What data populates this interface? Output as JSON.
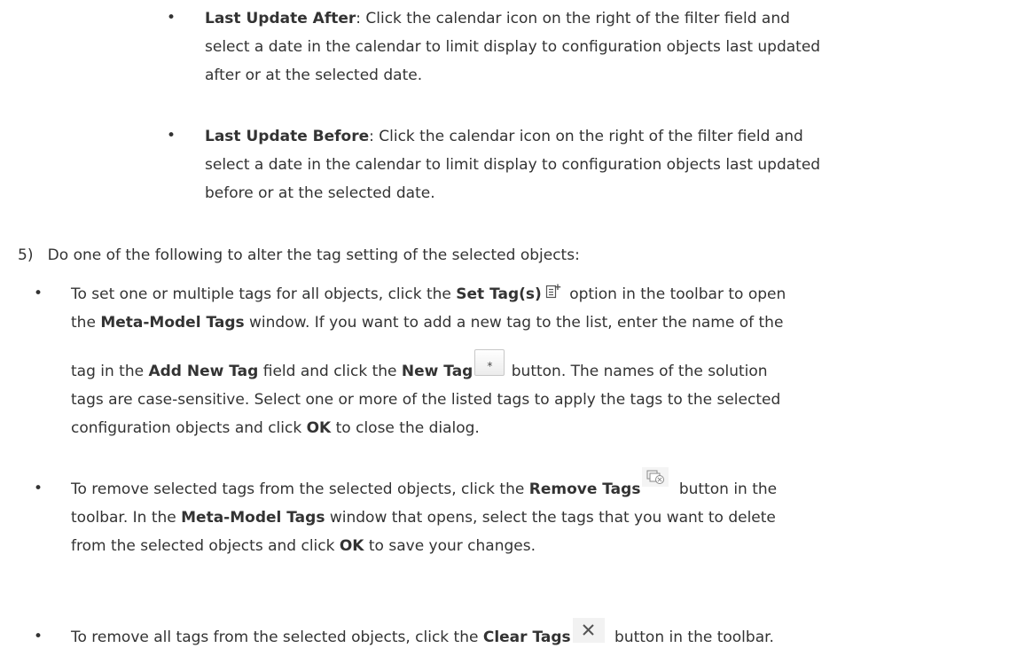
{
  "sub_bullets": [
    {
      "term": "Last Update After",
      "lines": [
        ": Click the calendar icon on the right of the filter field and",
        "select a date in the calendar to limit display to configuration objects last updated",
        "after or at the selected date."
      ]
    },
    {
      "term": "Last Update Before",
      "lines": [
        ": Click the calendar icon on the right of the filter field and",
        "select a date in the calendar to limit display to configuration objects last updated",
        "before or at the selected date."
      ]
    }
  ],
  "step": {
    "number": "5)",
    "text": "Do one of the following to alter the tag setting of the selected objects:"
  },
  "bullets": {
    "set_tags": {
      "l1_a": "To set one or multiple tags for all objects, click the ",
      "l1_b": "Set Tag(s)",
      "l1_c": " option in the toolbar to open",
      "l2_a": "the ",
      "l2_b": "Meta-Model Tags",
      "l2_c": " window. If you want to add a new tag to the list, enter the name of the",
      "l3_a": "tag in the ",
      "l3_b": "Add New Tag",
      "l3_c": " field and click the ",
      "l3_d": "New Tag",
      "l3_e": " button. The names of the solution",
      "l4": "tags are case-sensitive. Select one or more of the listed tags to apply the tags to the selected",
      "l5_a": "configuration objects and click ",
      "l5_b": "OK",
      "l5_c": " to close the dialog.",
      "new_tag_glyph": "*"
    },
    "remove_tags": {
      "l1_a": "To remove selected tags from the selected objects, click the ",
      "l1_b": "Remove Tags",
      "l1_c": " button in the",
      "l2_a": "toolbar. In the ",
      "l2_b": "Meta-Model Tags",
      "l2_c": " window that opens, select the tags that you want to delete",
      "l3_a": "from the selected objects and click ",
      "l3_b": "OK",
      "l3_c": " to save your changes."
    },
    "clear_tags": {
      "l1_a": "To remove all tags from the selected objects, click the ",
      "l1_b": "Clear Tags",
      "l1_c": " button in the toolbar.",
      "clear_glyph": "✕"
    }
  },
  "bullet_glyph": "•",
  "icons": {
    "set_tags": "set-tag-icon",
    "new_tag": "new-tag-icon",
    "remove_tags": "remove-tags-icon",
    "clear_tags": "clear-tags-icon"
  }
}
